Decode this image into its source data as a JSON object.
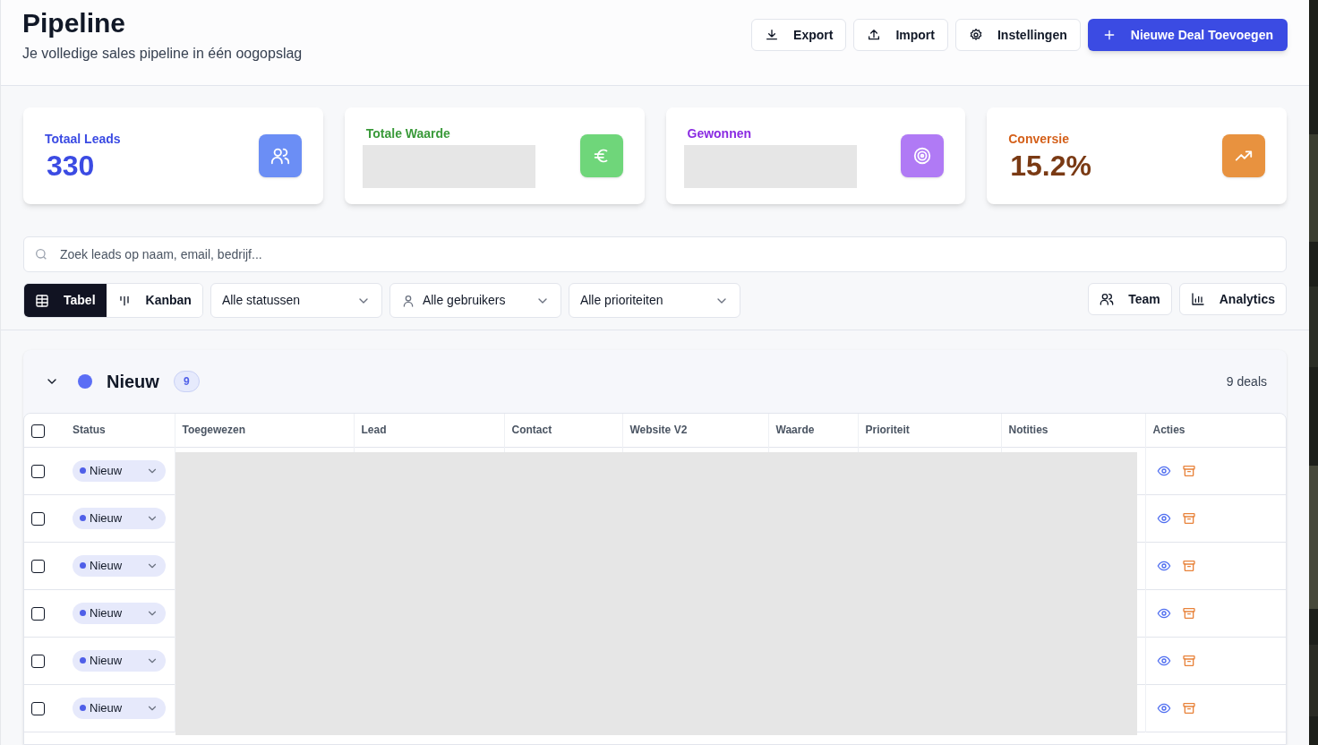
{
  "header": {
    "title": "Pipeline",
    "subtitle": "Je volledige sales pipeline in één oogopslag",
    "actions": [
      {
        "label": "Export",
        "kind": "download"
      },
      {
        "label": "Import",
        "kind": "upload"
      },
      {
        "label": "Instellingen",
        "kind": "settings"
      },
      {
        "label": "Nieuwe Deal Toevoegen",
        "kind": "primary"
      }
    ]
  },
  "stats": [
    {
      "label": "Totaal Leads",
      "value": "330",
      "kind": "leads"
    },
    {
      "label": "Totale Waarde",
      "redacted": true,
      "kind": "value"
    },
    {
      "label": "Gewonnen",
      "redacted": true,
      "kind": "won"
    },
    {
      "label": "Conversie",
      "value": "15.2%",
      "kind": "conversion"
    }
  ],
  "search": {
    "placeholder": "Zoek leads op naam, email, bedrijf..."
  },
  "views": [
    {
      "label": "Tabel",
      "kind": "table",
      "selected": true
    },
    {
      "label": "Kanban",
      "kind": "kanban",
      "selected": false
    }
  ],
  "filters": [
    {
      "label": "Alle statussen",
      "kind": "plain"
    },
    {
      "label": "Alle gebruikers",
      "kind": "user"
    },
    {
      "label": "Alle prioriteiten",
      "kind": "plain"
    }
  ],
  "tools": [
    {
      "label": "Team",
      "kind": "team"
    },
    {
      "label": "Analytics",
      "kind": "analytics"
    }
  ],
  "group": {
    "title": "Nieuw",
    "color": "#5b6ef5",
    "count": "9",
    "deals": "9 deals",
    "expanded": true
  },
  "table": {
    "select_all": false,
    "redacted": true,
    "columns": [
      "Status",
      "Toegewezen",
      "Lead",
      "Contact",
      "Website V2",
      "Waarde",
      "Prioriteit",
      "Notities",
      "Acties"
    ],
    "rows": [
      {
        "status": "Nieuw",
        "checked": false
      },
      {
        "status": "Nieuw",
        "checked": false
      },
      {
        "status": "Nieuw",
        "checked": false
      },
      {
        "status": "Nieuw",
        "checked": false
      },
      {
        "status": "Nieuw",
        "checked": false
      },
      {
        "status": "Nieuw",
        "checked": false
      }
    ]
  }
}
